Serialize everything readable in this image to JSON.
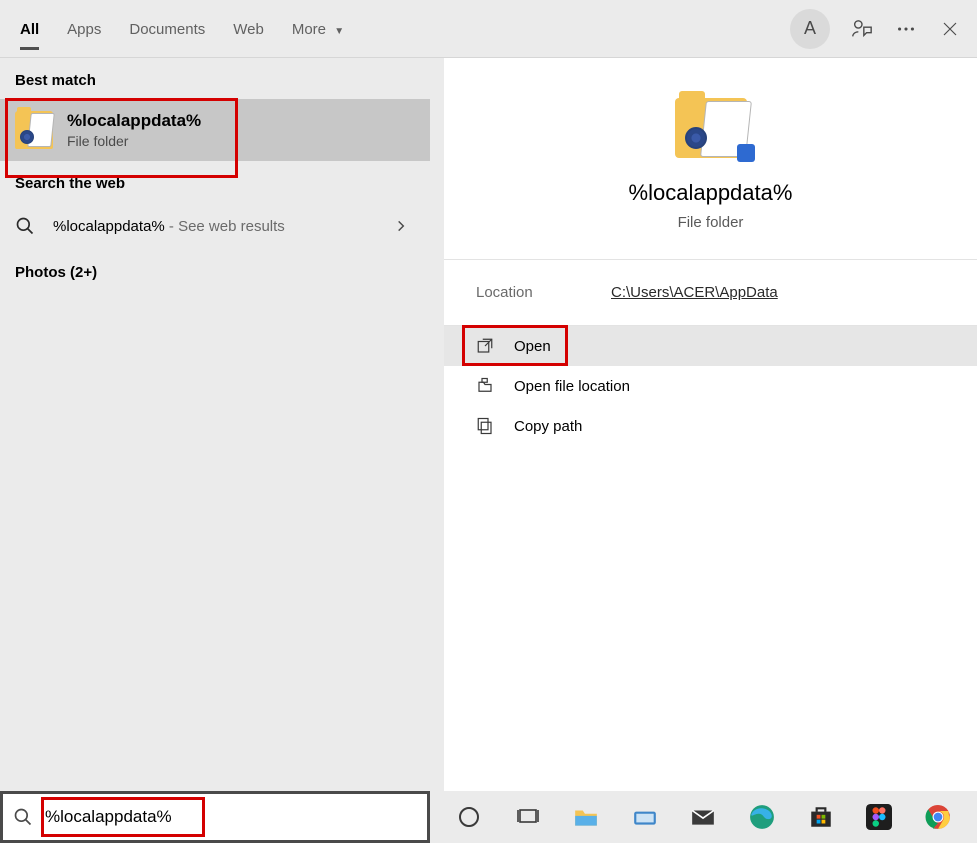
{
  "tabs": {
    "all": "All",
    "apps": "Apps",
    "documents": "Documents",
    "web": "Web",
    "more": "More"
  },
  "avatar_initial": "A",
  "left": {
    "best_match_label": "Best match",
    "bm_title": "%localappdata%",
    "bm_sub": "File folder",
    "search_web_label": "Search the web",
    "web_query": "%localappdata%",
    "web_suffix": " - See web results",
    "photos_label": "Photos (2+)"
  },
  "preview": {
    "title": "%localappdata%",
    "sub": "File folder",
    "location_label": "Location",
    "location_path": "C:\\Users\\ACER\\AppData"
  },
  "actions": {
    "open": "Open",
    "open_location": "Open file location",
    "copy_path": "Copy path"
  },
  "search_value": "%localappdata%"
}
